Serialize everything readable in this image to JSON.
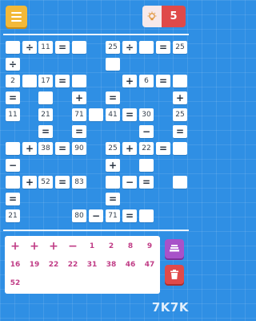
{
  "header": {
    "menu_icon": "hamburger-menu-icon",
    "hint_icon": "lightbulb-icon",
    "hints_remaining": "5"
  },
  "board": {
    "cells": [
      {
        "text": "",
        "op": false
      },
      {
        "text": "÷",
        "op": true
      },
      {
        "text": "11",
        "op": false
      },
      {
        "text": "=",
        "op": true
      },
      {
        "text": "",
        "op": false
      },
      {
        "text": "25",
        "op": false
      },
      {
        "text": "÷",
        "op": true
      },
      {
        "text": "",
        "op": false
      },
      {
        "text": "=",
        "op": true
      },
      {
        "text": "25",
        "op": false
      },
      {
        "text": "÷",
        "op": true
      },
      {
        "text": "",
        "op": false
      },
      {
        "text": "2",
        "op": false
      },
      {
        "text": "",
        "op": false
      },
      {
        "text": "17",
        "op": false
      },
      {
        "text": "=",
        "op": true
      },
      {
        "text": "",
        "op": false
      },
      {
        "text": "+",
        "op": true
      },
      {
        "text": "6",
        "op": false
      },
      {
        "text": "=",
        "op": true
      },
      {
        "text": "",
        "op": false
      },
      {
        "text": "=",
        "op": true
      },
      {
        "text": "",
        "op": false
      },
      {
        "text": "+",
        "op": true
      },
      {
        "text": "=",
        "op": true
      },
      {
        "text": "+",
        "op": true
      },
      {
        "text": "11",
        "op": false
      },
      {
        "text": "21",
        "op": false
      },
      {
        "text": "71",
        "op": false
      },
      {
        "text": "",
        "op": false
      },
      {
        "text": "41",
        "op": false
      },
      {
        "text": "=",
        "op": true
      },
      {
        "text": "30",
        "op": false
      },
      {
        "text": "25",
        "op": false
      },
      {
        "text": "=",
        "op": true
      },
      {
        "text": "=",
        "op": true
      },
      {
        "text": "−",
        "op": true
      },
      {
        "text": "=",
        "op": true
      },
      {
        "text": "",
        "op": false
      },
      {
        "text": "+",
        "op": true
      },
      {
        "text": "38",
        "op": false
      },
      {
        "text": "=",
        "op": true
      },
      {
        "text": "90",
        "op": false
      },
      {
        "text": "25",
        "op": false
      },
      {
        "text": "+",
        "op": true
      },
      {
        "text": "22",
        "op": false
      },
      {
        "text": "=",
        "op": true
      },
      {
        "text": "",
        "op": false
      },
      {
        "text": "−",
        "op": true
      },
      {
        "text": "+",
        "op": true
      },
      {
        "text": "",
        "op": false
      },
      {
        "text": "",
        "op": false
      },
      {
        "text": "+",
        "op": true
      },
      {
        "text": "52",
        "op": false
      },
      {
        "text": "=",
        "op": true
      },
      {
        "text": "83",
        "op": false
      },
      {
        "text": "",
        "op": false
      },
      {
        "text": "−",
        "op": true
      },
      {
        "text": "=",
        "op": true
      },
      {
        "text": "",
        "op": false
      },
      {
        "text": "=",
        "op": true
      },
      {
        "text": "=",
        "op": true
      },
      {
        "text": "21",
        "op": false
      },
      {
        "text": "80",
        "op": false
      },
      {
        "text": "−",
        "op": true
      },
      {
        "text": "71",
        "op": false
      },
      {
        "text": "=",
        "op": true
      },
      {
        "text": "",
        "op": false
      }
    ]
  },
  "tray": {
    "tiles": [
      "+",
      "+",
      "+",
      "−",
      "1",
      "2",
      "8",
      "9",
      "16",
      "19",
      "22",
      "22",
      "31",
      "38",
      "46",
      "47",
      "52"
    ]
  },
  "side": {
    "stack_icon": "stack-layers-icon",
    "trash_icon": "trash-icon"
  },
  "watermark": "7K7K"
}
